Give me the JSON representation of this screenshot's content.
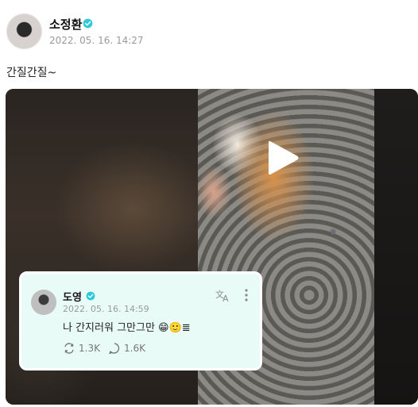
{
  "post": {
    "username": "소정환",
    "timestamp": "2022. 05. 16. 14:27",
    "text": "간질간질~",
    "verified": true,
    "accent_color": "#2ecad9"
  },
  "media": {
    "type": "video",
    "play_icon": "play-icon"
  },
  "quote": {
    "username": "도영",
    "timestamp": "2022. 05. 16. 14:59",
    "text": "나 간지러워 그만그만 😁🙂≣",
    "translate_icon": "translate-icon",
    "more_icon": "more-vertical-icon",
    "reposts": "1.3K",
    "comments": "1.6K"
  }
}
